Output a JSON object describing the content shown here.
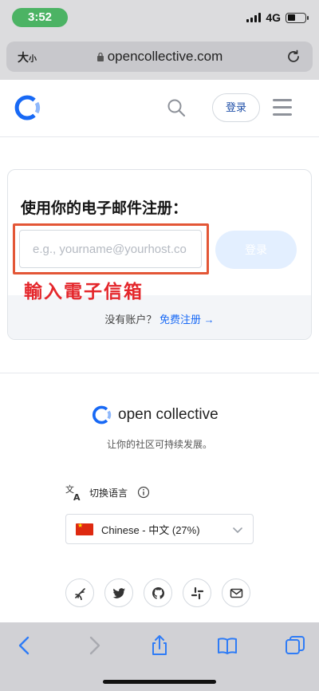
{
  "status_bar": {
    "time": "3:52",
    "network": "4G"
  },
  "browser": {
    "text_size_label": "大",
    "text_size_small": "小",
    "url": "opencollective.com"
  },
  "header": {
    "login_label": "登录"
  },
  "signup_card": {
    "title": "使用你的电子邮件注册：",
    "email_placeholder": "e.g., yourname@yourhost.co",
    "submit_label": "登录",
    "no_account_text": "没有账户？",
    "signup_link": "免费注册 →"
  },
  "annotation": {
    "text": "輸入電子信箱",
    "color": "#e4262b"
  },
  "footer": {
    "brand": "open collective",
    "tagline": "让你的社区可持续发展。",
    "language_label": "切换语言",
    "language_selected": "Chinese - 中文 (27%)",
    "social_icons": [
      "blog-icon",
      "twitter-icon",
      "github-icon",
      "slack-icon",
      "mail-icon"
    ]
  },
  "colors": {
    "brand_blue": "#1869f5",
    "time_pill": "#4cb364",
    "highlight_border": "#e35636"
  }
}
